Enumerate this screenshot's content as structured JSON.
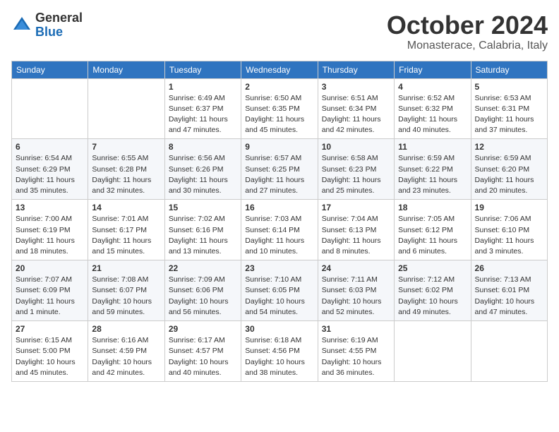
{
  "logo": {
    "general": "General",
    "blue": "Blue"
  },
  "header": {
    "month": "October 2024",
    "location": "Monasterace, Calabria, Italy"
  },
  "weekdays": [
    "Sunday",
    "Monday",
    "Tuesday",
    "Wednesday",
    "Thursday",
    "Friday",
    "Saturday"
  ],
  "weeks": [
    [
      {
        "day": "",
        "info": ""
      },
      {
        "day": "",
        "info": ""
      },
      {
        "day": "1",
        "info": "Sunrise: 6:49 AM\nSunset: 6:37 PM\nDaylight: 11 hours\nand 47 minutes."
      },
      {
        "day": "2",
        "info": "Sunrise: 6:50 AM\nSunset: 6:35 PM\nDaylight: 11 hours\nand 45 minutes."
      },
      {
        "day": "3",
        "info": "Sunrise: 6:51 AM\nSunset: 6:34 PM\nDaylight: 11 hours\nand 42 minutes."
      },
      {
        "day": "4",
        "info": "Sunrise: 6:52 AM\nSunset: 6:32 PM\nDaylight: 11 hours\nand 40 minutes."
      },
      {
        "day": "5",
        "info": "Sunrise: 6:53 AM\nSunset: 6:31 PM\nDaylight: 11 hours\nand 37 minutes."
      }
    ],
    [
      {
        "day": "6",
        "info": "Sunrise: 6:54 AM\nSunset: 6:29 PM\nDaylight: 11 hours\nand 35 minutes."
      },
      {
        "day": "7",
        "info": "Sunrise: 6:55 AM\nSunset: 6:28 PM\nDaylight: 11 hours\nand 32 minutes."
      },
      {
        "day": "8",
        "info": "Sunrise: 6:56 AM\nSunset: 6:26 PM\nDaylight: 11 hours\nand 30 minutes."
      },
      {
        "day": "9",
        "info": "Sunrise: 6:57 AM\nSunset: 6:25 PM\nDaylight: 11 hours\nand 27 minutes."
      },
      {
        "day": "10",
        "info": "Sunrise: 6:58 AM\nSunset: 6:23 PM\nDaylight: 11 hours\nand 25 minutes."
      },
      {
        "day": "11",
        "info": "Sunrise: 6:59 AM\nSunset: 6:22 PM\nDaylight: 11 hours\nand 23 minutes."
      },
      {
        "day": "12",
        "info": "Sunrise: 6:59 AM\nSunset: 6:20 PM\nDaylight: 11 hours\nand 20 minutes."
      }
    ],
    [
      {
        "day": "13",
        "info": "Sunrise: 7:00 AM\nSunset: 6:19 PM\nDaylight: 11 hours\nand 18 minutes."
      },
      {
        "day": "14",
        "info": "Sunrise: 7:01 AM\nSunset: 6:17 PM\nDaylight: 11 hours\nand 15 minutes."
      },
      {
        "day": "15",
        "info": "Sunrise: 7:02 AM\nSunset: 6:16 PM\nDaylight: 11 hours\nand 13 minutes."
      },
      {
        "day": "16",
        "info": "Sunrise: 7:03 AM\nSunset: 6:14 PM\nDaylight: 11 hours\nand 10 minutes."
      },
      {
        "day": "17",
        "info": "Sunrise: 7:04 AM\nSunset: 6:13 PM\nDaylight: 11 hours\nand 8 minutes."
      },
      {
        "day": "18",
        "info": "Sunrise: 7:05 AM\nSunset: 6:12 PM\nDaylight: 11 hours\nand 6 minutes."
      },
      {
        "day": "19",
        "info": "Sunrise: 7:06 AM\nSunset: 6:10 PM\nDaylight: 11 hours\nand 3 minutes."
      }
    ],
    [
      {
        "day": "20",
        "info": "Sunrise: 7:07 AM\nSunset: 6:09 PM\nDaylight: 11 hours\nand 1 minute."
      },
      {
        "day": "21",
        "info": "Sunrise: 7:08 AM\nSunset: 6:07 PM\nDaylight: 10 hours\nand 59 minutes."
      },
      {
        "day": "22",
        "info": "Sunrise: 7:09 AM\nSunset: 6:06 PM\nDaylight: 10 hours\nand 56 minutes."
      },
      {
        "day": "23",
        "info": "Sunrise: 7:10 AM\nSunset: 6:05 PM\nDaylight: 10 hours\nand 54 minutes."
      },
      {
        "day": "24",
        "info": "Sunrise: 7:11 AM\nSunset: 6:03 PM\nDaylight: 10 hours\nand 52 minutes."
      },
      {
        "day": "25",
        "info": "Sunrise: 7:12 AM\nSunset: 6:02 PM\nDaylight: 10 hours\nand 49 minutes."
      },
      {
        "day": "26",
        "info": "Sunrise: 7:13 AM\nSunset: 6:01 PM\nDaylight: 10 hours\nand 47 minutes."
      }
    ],
    [
      {
        "day": "27",
        "info": "Sunrise: 6:15 AM\nSunset: 5:00 PM\nDaylight: 10 hours\nand 45 minutes."
      },
      {
        "day": "28",
        "info": "Sunrise: 6:16 AM\nSunset: 4:59 PM\nDaylight: 10 hours\nand 42 minutes."
      },
      {
        "day": "29",
        "info": "Sunrise: 6:17 AM\nSunset: 4:57 PM\nDaylight: 10 hours\nand 40 minutes."
      },
      {
        "day": "30",
        "info": "Sunrise: 6:18 AM\nSunset: 4:56 PM\nDaylight: 10 hours\nand 38 minutes."
      },
      {
        "day": "31",
        "info": "Sunrise: 6:19 AM\nSunset: 4:55 PM\nDaylight: 10 hours\nand 36 minutes."
      },
      {
        "day": "",
        "info": ""
      },
      {
        "day": "",
        "info": ""
      }
    ]
  ]
}
